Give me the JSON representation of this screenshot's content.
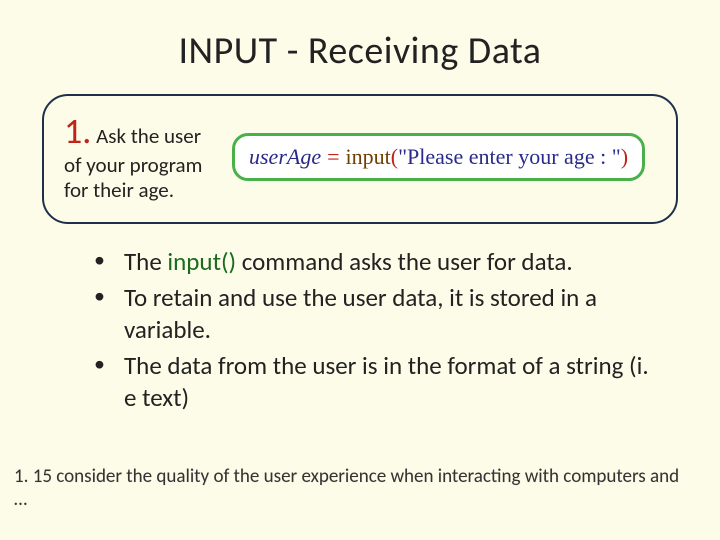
{
  "title": "INPUT - Receiving Data",
  "callout": {
    "step_number": "1.",
    "step_text": "Ask the user of your program for their age.",
    "code": {
      "var": "userAge",
      "eq": "=",
      "func": "input",
      "open": "(",
      "str": "\"Please enter your age : \"",
      "close": ")"
    }
  },
  "bullets": {
    "b1_pre": "The ",
    "b1_fn": "input()",
    "b1_post": " command asks the user for data.",
    "b2": "To retain and use the user data, it is stored in a variable.",
    "b3": "The data from the user is in the format of a string (i. e text)"
  },
  "footer": "1. 15 consider the quality of the user experience when interacting with computers and …"
}
